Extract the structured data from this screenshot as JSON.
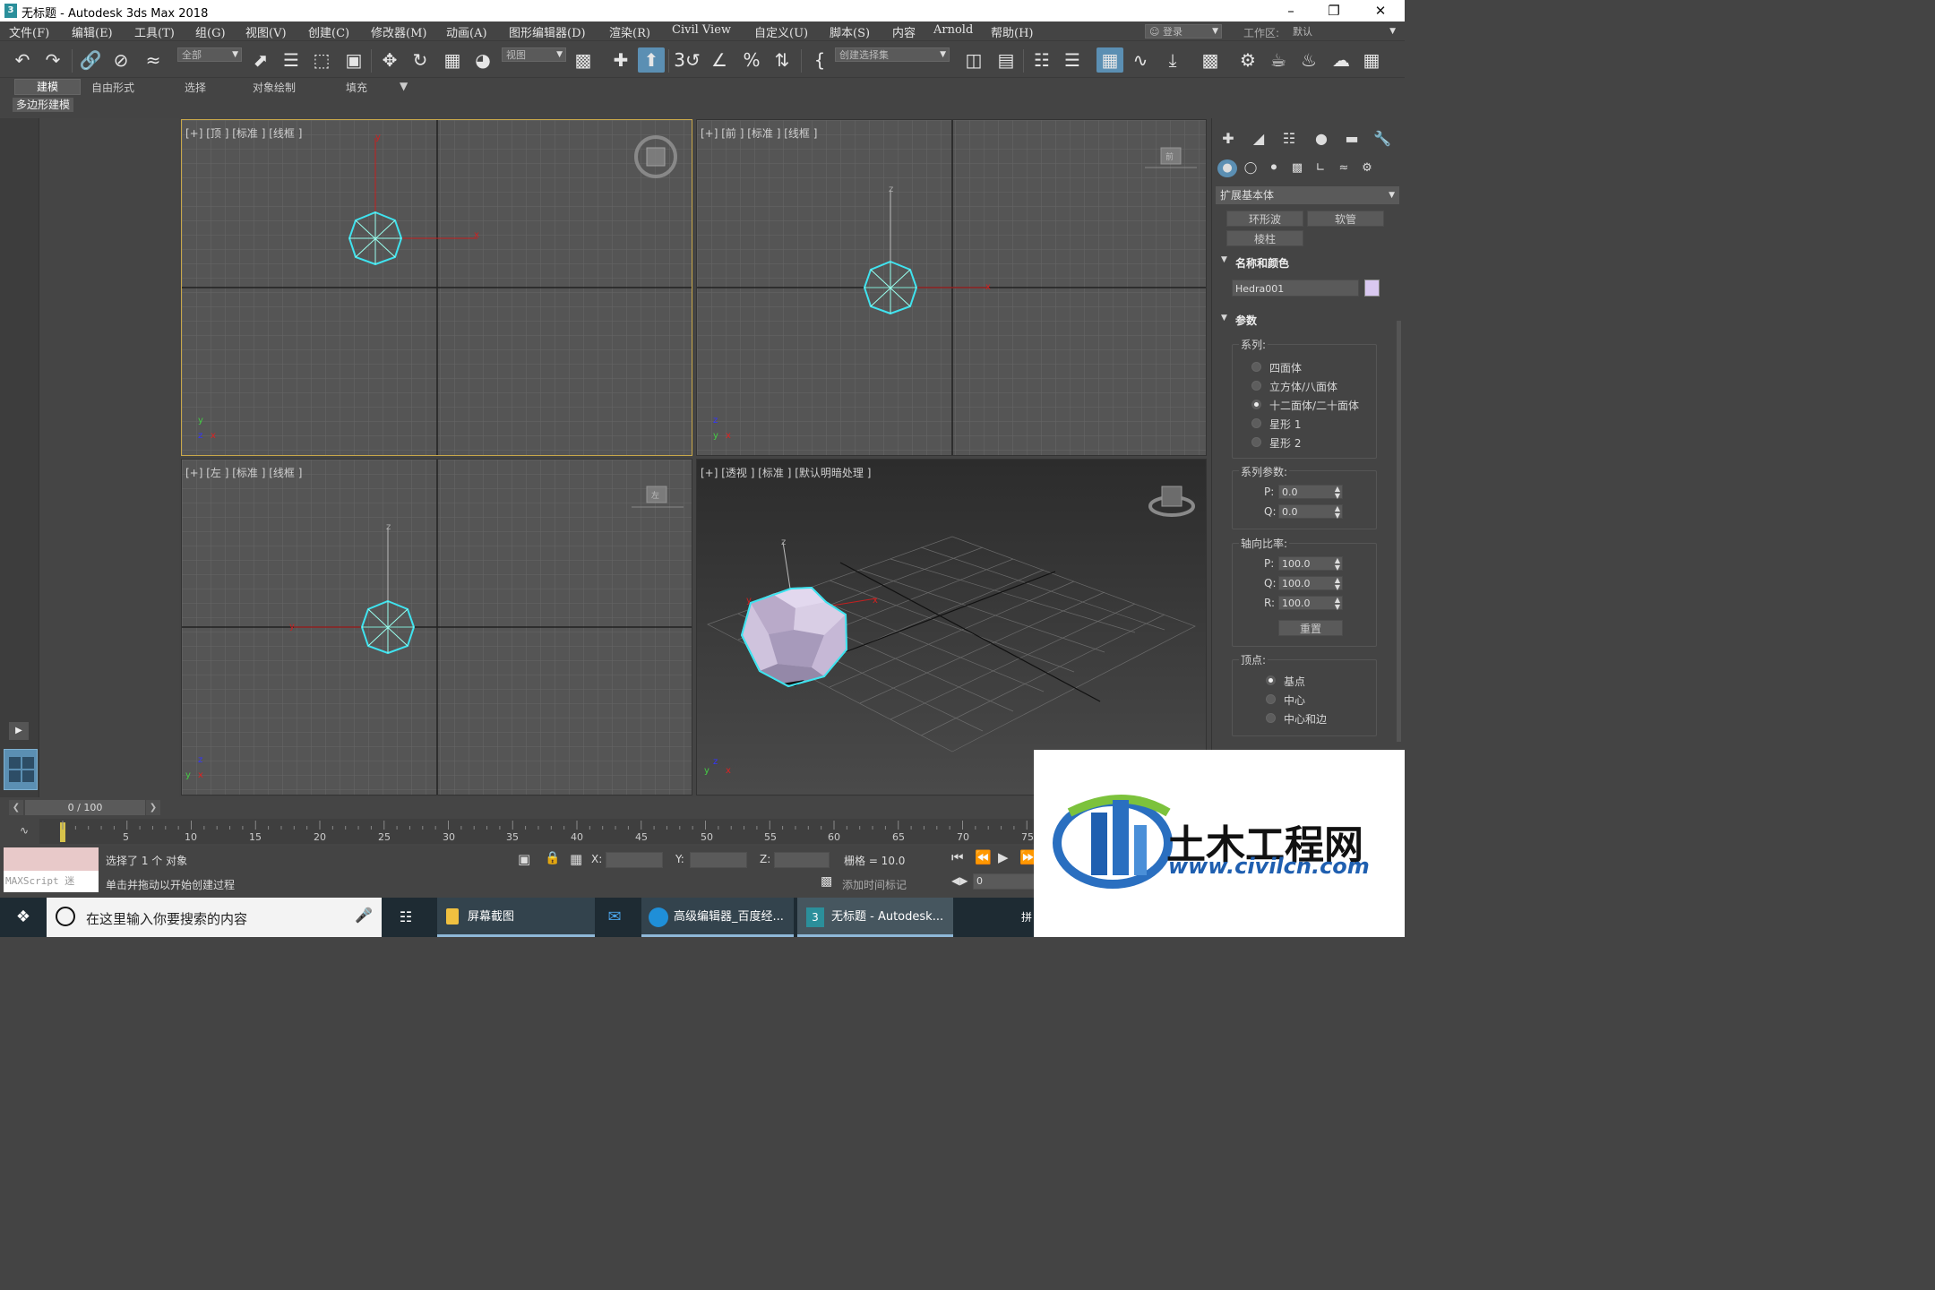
{
  "window": {
    "title": "无标题 - Autodesk 3ds Max 2018",
    "app_icon": "3"
  },
  "menu": [
    "文件(F)",
    "编辑(E)",
    "工具(T)",
    "组(G)",
    "视图(V)",
    "创建(C)",
    "修改器(M)",
    "动画(A)",
    "图形编辑器(D)",
    "渲染(R)",
    "Civil View",
    "自定义(U)",
    "脚本(S)",
    "内容",
    "Arnold",
    "帮助(H)"
  ],
  "account": {
    "label": "登录"
  },
  "workspace": {
    "label": "工作区:",
    "value": "默认"
  },
  "toolbar": {
    "filter_combo": "全部",
    "refcoord_combo": "视图",
    "selection_set_combo": "创建选择集"
  },
  "ribbon": {
    "tabs": [
      "建模",
      "自由形式",
      "选择",
      "对象绘制",
      "填充"
    ],
    "active": "建模",
    "sub_label": "多边形建模"
  },
  "viewports": {
    "top": {
      "label": "[+] [顶 ] [标准 ] [线框 ]",
      "axis_x": "x",
      "axis_y": "y"
    },
    "front": {
      "label": "[+] [前 ] [标准 ] [线框 ]",
      "axis_x": "x",
      "axis_z": "z",
      "cube_label": "前"
    },
    "left": {
      "label": "[+] [左 ] [标准 ] [线框 ]",
      "axis_y": "y",
      "axis_z": "z",
      "cube_label": "左"
    },
    "persp": {
      "label": "[+] [透视 ] [标准 ] [默认明暗处理 ]",
      "axis_x": "x",
      "axis_y": "y",
      "axis_z": "z"
    }
  },
  "command_panel": {
    "category_dropdown": "扩展基本体",
    "buttons": [
      "环形波",
      "软管",
      "棱柱"
    ],
    "name_color": {
      "title": "名称和颜色",
      "name": "Hedra001",
      "swatch_color": "#d9c8f0"
    },
    "params": {
      "title": "参数",
      "family_label": "系列:",
      "family": [
        "四面体",
        "立方体/八面体",
        "十二面体/二十面体",
        "星形 1",
        "星形 2"
      ],
      "family_selected": 2,
      "family_params_label": "系列参数:",
      "p": {
        "label": "P:",
        "value": "0.0"
      },
      "q": {
        "label": "Q:",
        "value": "0.0"
      },
      "axis_ratio_label": "轴向比率:",
      "ap": {
        "label": "P:",
        "value": "100.0"
      },
      "aq": {
        "label": "Q:",
        "value": "100.0"
      },
      "ar": {
        "label": "R:",
        "value": "100.0"
      },
      "reset_button": "重置",
      "vertex_label": "顶点:",
      "vertex": [
        "基点",
        "中心",
        "中心和边"
      ],
      "vertex_selected": 0
    }
  },
  "timeline": {
    "frame_display": "0 / 100",
    "ticks": [
      "5",
      "10",
      "15",
      "20",
      "25",
      "30",
      "35",
      "40",
      "45",
      "50",
      "55",
      "60",
      "65",
      "70",
      "75"
    ]
  },
  "status": {
    "maxscript": "MAXScript 迷",
    "line1": "选择了 1 个 对象",
    "line2": "单击并拖动以开始创建过程",
    "x_label": "X:",
    "y_label": "Y:",
    "z_label": "Z:",
    "grid": "栅格 = 10.0",
    "add_time_tag": "添加时间标记",
    "frame_field": "0"
  },
  "taskbar": {
    "search_placeholder": "在这里输入你要搜索的内容",
    "items": [
      "屏幕截图",
      "高级编辑器_百度经...",
      "无标题 - Autodesk..."
    ],
    "ime": "拼"
  },
  "watermark": {
    "title": "土木工程网",
    "url": "www.civilcn.com"
  },
  "colors": {
    "accent": "#5b8fb3",
    "viewport_bg": "#555555",
    "selection_cyan": "#3fe3ef",
    "axis_red": "#d02020"
  }
}
